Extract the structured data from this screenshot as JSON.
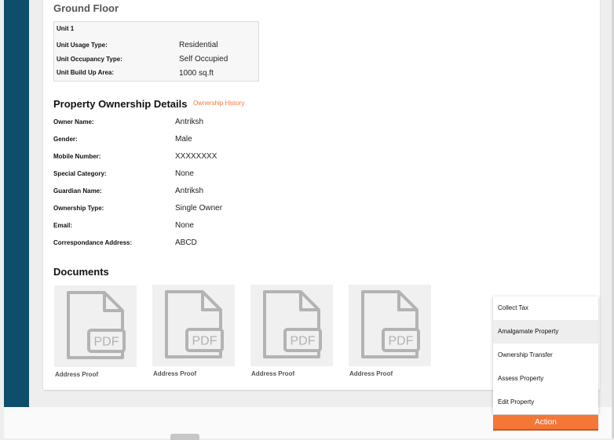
{
  "floor": {
    "title": "Ground Floor",
    "unit": {
      "name": "Unit 1",
      "rows": [
        {
          "label": "Unit Usage Type:",
          "value": "Residential"
        },
        {
          "label": "Unit Occupancy Type:",
          "value": "Self Occupied"
        },
        {
          "label": "Unit Build Up Area:",
          "value": "1000 sq.ft"
        }
      ]
    }
  },
  "ownership": {
    "title": "Property Ownership Details",
    "history_link": "Ownership History",
    "rows": [
      {
        "label": "Owner Name:",
        "value": "Antriksh"
      },
      {
        "label": "Gender:",
        "value": "Male"
      },
      {
        "label": "Mobile Number:",
        "value": "XXXXXXXX"
      },
      {
        "label": "Special Category:",
        "value": "None"
      },
      {
        "label": "Guardian Name:",
        "value": "Antriksh"
      },
      {
        "label": "Ownership Type:",
        "value": "Single Owner"
      },
      {
        "label": "Email:",
        "value": "None"
      },
      {
        "label": "Correspondance Address:",
        "value": "ABCD"
      }
    ]
  },
  "documents": {
    "title": "Documents",
    "icon": "pdf-file-icon",
    "icon_text": "PDF",
    "items": [
      {
        "label": "Address Proof"
      },
      {
        "label": "Address Proof"
      },
      {
        "label": "Address Proof"
      },
      {
        "label": "Address Proof"
      }
    ]
  },
  "action_menu": {
    "items": [
      {
        "label": "Collect Tax"
      },
      {
        "label": "Amalgamate Property",
        "highlighted": true
      },
      {
        "label": "Ownership Transfer"
      },
      {
        "label": "Assess Property"
      },
      {
        "label": "Edit Property"
      }
    ],
    "button_label": "Action"
  },
  "colors": {
    "sidebar": "#0e4e6a",
    "accent": "#f47738",
    "menu_highlight": "#eeeeee"
  }
}
